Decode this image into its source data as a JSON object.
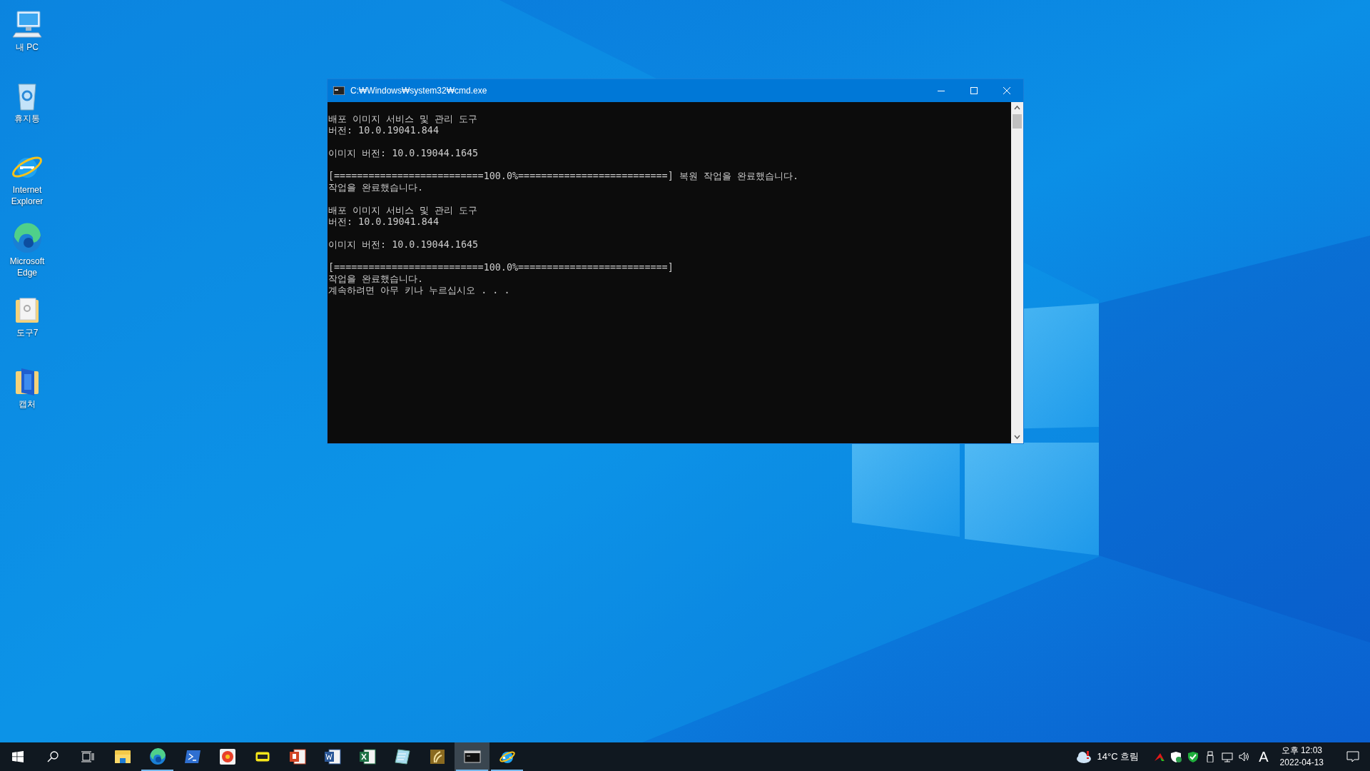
{
  "desktop_icons": [
    {
      "label": "내 PC"
    },
    {
      "label": "휴지통"
    },
    {
      "label": "Internet Explorer"
    },
    {
      "label": "Microsoft Edge"
    },
    {
      "label": "도구7"
    },
    {
      "label": "캡처"
    }
  ],
  "console_window": {
    "title": "C:₩Windows₩system32₩cmd.exe",
    "output_blocks": [
      [
        "배포 이미지 서비스 및 관리 도구",
        "버전: 10.0.19041.844"
      ],
      [
        "이미지 버전: 10.0.19044.1645"
      ],
      [
        "[==========================100.0%==========================] 복원 작업을 완료했습니다.",
        "작업을 완료했습니다."
      ],
      [
        "배포 이미지 서비스 및 관리 도구",
        "버전: 10.0.19041.844"
      ],
      [
        "이미지 버전: 10.0.19044.1645"
      ],
      [
        "[==========================100.0%==========================]",
        "작업을 완료했습니다.",
        "계속하려면 아무 키나 누르십시오 . . ."
      ]
    ]
  },
  "taskbar": {
    "apps": [
      {
        "running": false,
        "active": false
      },
      {
        "running": true,
        "active": false
      },
      {
        "running": false,
        "active": false
      },
      {
        "running": false,
        "active": false
      },
      {
        "running": false,
        "active": false
      },
      {
        "running": false,
        "active": false
      },
      {
        "running": false,
        "active": false
      },
      {
        "running": false,
        "active": false
      },
      {
        "running": false,
        "active": false
      },
      {
        "running": false,
        "active": false
      },
      {
        "running": true,
        "active": true
      },
      {
        "running": true,
        "active": false
      }
    ],
    "weather": "14°C 흐림",
    "input_indicator": "A",
    "time": "오후 12:03",
    "date": "2022-04-13"
  }
}
